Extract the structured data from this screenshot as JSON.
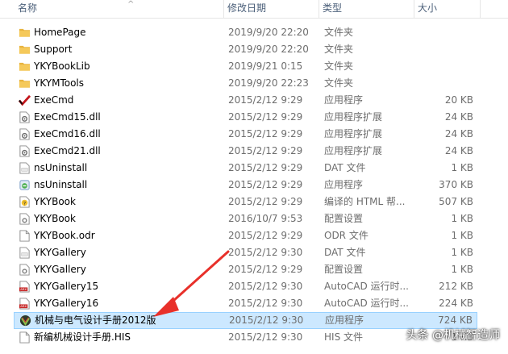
{
  "columns": {
    "name": "名称",
    "date": "修改日期",
    "type": "类型",
    "size": "大小",
    "sort_indicator": "^"
  },
  "files": [
    {
      "name": "HomePage",
      "date": "2019/9/20 22:20",
      "type": "文件夹",
      "size": "",
      "icon": "folder-icon"
    },
    {
      "name": "Support",
      "date": "2019/9/20 22:20",
      "type": "文件夹",
      "size": "",
      "icon": "folder-icon"
    },
    {
      "name": "YKYBookLib",
      "date": "2019/9/21 0:15",
      "type": "文件夹",
      "size": "",
      "icon": "folder-icon"
    },
    {
      "name": "YKYMTools",
      "date": "2019/9/20 22:23",
      "type": "文件夹",
      "size": "",
      "icon": "folder-icon"
    },
    {
      "name": "ExeCmd",
      "date": "2015/2/12 9:29",
      "type": "应用程序",
      "size": "20 KB",
      "icon": "checkmark-app-icon"
    },
    {
      "name": "ExeCmd15.dll",
      "date": "2015/2/12 9:29",
      "type": "应用程序扩展",
      "size": "24 KB",
      "icon": "dll-gear-icon"
    },
    {
      "name": "ExeCmd16.dll",
      "date": "2015/2/12 9:29",
      "type": "应用程序扩展",
      "size": "24 KB",
      "icon": "dll-gear-icon"
    },
    {
      "name": "ExeCmd21.dll",
      "date": "2015/2/12 9:29",
      "type": "应用程序扩展",
      "size": "24 KB",
      "icon": "dll-gear-icon"
    },
    {
      "name": "nsUninstall",
      "date": "2015/2/12 9:29",
      "type": "DAT 文件",
      "size": "1 KB",
      "icon": "dat-file-icon"
    },
    {
      "name": "nsUninstall",
      "date": "2015/2/12 9:29",
      "type": "应用程序",
      "size": "370 KB",
      "icon": "uninstaller-icon"
    },
    {
      "name": "YKYBook",
      "date": "2015/2/12 9:29",
      "type": "编译的 HTML 帮...",
      "size": "507 KB",
      "icon": "help-file-icon"
    },
    {
      "name": "YKYBook",
      "date": "2016/10/7 9:53",
      "type": "配置设置",
      "size": "1 KB",
      "icon": "config-file-icon"
    },
    {
      "name": "YKYBook.odr",
      "date": "2015/2/12 9:29",
      "type": "ODR 文件",
      "size": "1 KB",
      "icon": "blank-file-icon"
    },
    {
      "name": "YKYGallery",
      "date": "2015/2/12 9:30",
      "type": "DAT 文件",
      "size": "1 KB",
      "icon": "dat-file-icon"
    },
    {
      "name": "YKYGallery",
      "date": "2015/2/12 9:29",
      "type": "配置设置",
      "size": "1 KB",
      "icon": "config-file-icon"
    },
    {
      "name": "YKYGallery15",
      "date": "2015/2/12 9:30",
      "type": "AutoCAD 运行时...",
      "size": "212 KB",
      "icon": "arx-file-icon"
    },
    {
      "name": "YKYGallery16",
      "date": "2015/2/12 9:30",
      "type": "AutoCAD 运行时...",
      "size": "224 KB",
      "icon": "arx-file-icon"
    },
    {
      "name": "机械与电气设计手册2012版",
      "date": "2015/2/12 9:30",
      "type": "应用程序",
      "size": "724 KB",
      "icon": "handbook-app-icon",
      "selected": true
    },
    {
      "name": "新编机械设计手册.HIS",
      "date": "2015/2/12 9:30",
      "type": "HIS 文件",
      "size": "1 KB",
      "icon": "blank-file-icon"
    }
  ],
  "watermark": "头条 @机械智造师",
  "colors": {
    "selection_bg": "#cce8ff",
    "selection_border": "#99d1ff",
    "folder": "#f5c95a",
    "arrow": "#e8302a"
  }
}
